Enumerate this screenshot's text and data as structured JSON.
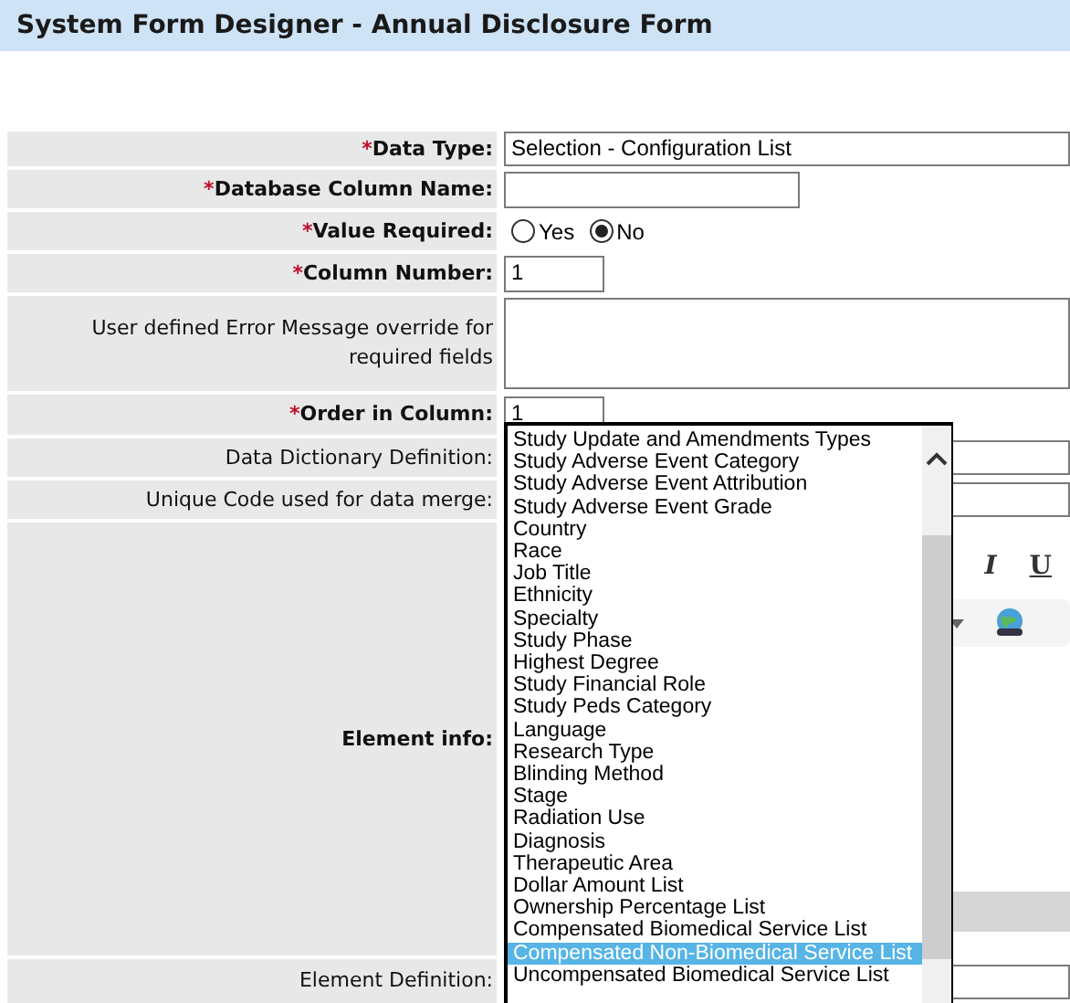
{
  "title": "System Form Designer - Annual Disclosure Form",
  "fields": [
    {
      "kind": "select",
      "label": "Data Type:",
      "marker": "*",
      "bold": true,
      "value": "Selection - Configuration List"
    },
    {
      "kind": "text",
      "label": "Database Column Name:",
      "marker": "*",
      "bold": true
    },
    {
      "kind": "radio",
      "label": "Value Required:",
      "marker": "*",
      "bold": true,
      "options": [
        {
          "label": "Yes",
          "selected": false
        },
        {
          "label": "No",
          "selected": true
        }
      ]
    },
    {
      "kind": "number",
      "label": "Column Number:",
      "marker": "*",
      "bold": true,
      "value": "1"
    },
    {
      "kind": "textarea",
      "label": "User defined Error Message override for required fields",
      "bold": false
    },
    {
      "kind": "number",
      "label": "Order in Column:",
      "marker": "*",
      "bold": true,
      "value": "1"
    },
    {
      "kind": "text",
      "label": "Data Dictionary Definition:",
      "bold": false
    },
    {
      "kind": "text",
      "label": "Unique Code used for data merge:",
      "bold": false
    },
    {
      "kind": "editor",
      "label": "Element info:",
      "bold": true,
      "tools": [
        {
          "label": "I"
        },
        {
          "label": "U"
        }
      ]
    },
    {
      "kind": "text",
      "label": "Element Definition:",
      "bold": false
    }
  ],
  "dropdown": {
    "options": [
      {
        "label": "Study Update and Amendments Types",
        "selected": false
      },
      {
        "label": "Study Adverse Event Category",
        "selected": false
      },
      {
        "label": "Study Adverse Event Attribution",
        "selected": false
      },
      {
        "label": "Study Adverse Event Grade",
        "selected": false
      },
      {
        "label": "Country",
        "selected": false
      },
      {
        "label": "Race",
        "selected": false
      },
      {
        "label": "Job Title",
        "selected": false
      },
      {
        "label": "Ethnicity",
        "selected": false
      },
      {
        "label": "Specialty",
        "selected": false
      },
      {
        "label": "Study Phase",
        "selected": false
      },
      {
        "label": "Highest Degree",
        "selected": false
      },
      {
        "label": "Study Financial Role",
        "selected": false
      },
      {
        "label": "Study Peds Category",
        "selected": false
      },
      {
        "label": "Language",
        "selected": false
      },
      {
        "label": "Research Type",
        "selected": false
      },
      {
        "label": "Blinding Method",
        "selected": false
      },
      {
        "label": "Stage",
        "selected": false
      },
      {
        "label": "Radiation Use",
        "selected": false
      },
      {
        "label": "Diagnosis",
        "selected": false
      },
      {
        "label": "Therapeutic Area",
        "selected": false
      },
      {
        "label": "Dollar Amount List",
        "selected": false
      },
      {
        "label": "Ownership Percentage List",
        "selected": false
      },
      {
        "label": "Compensated Biomedical Service List",
        "selected": false
      },
      {
        "label": "Compensated Non-Biomedical Service List",
        "selected": true
      },
      {
        "label": "Uncompensated Biomedical Service List",
        "selected": false
      }
    ]
  }
}
